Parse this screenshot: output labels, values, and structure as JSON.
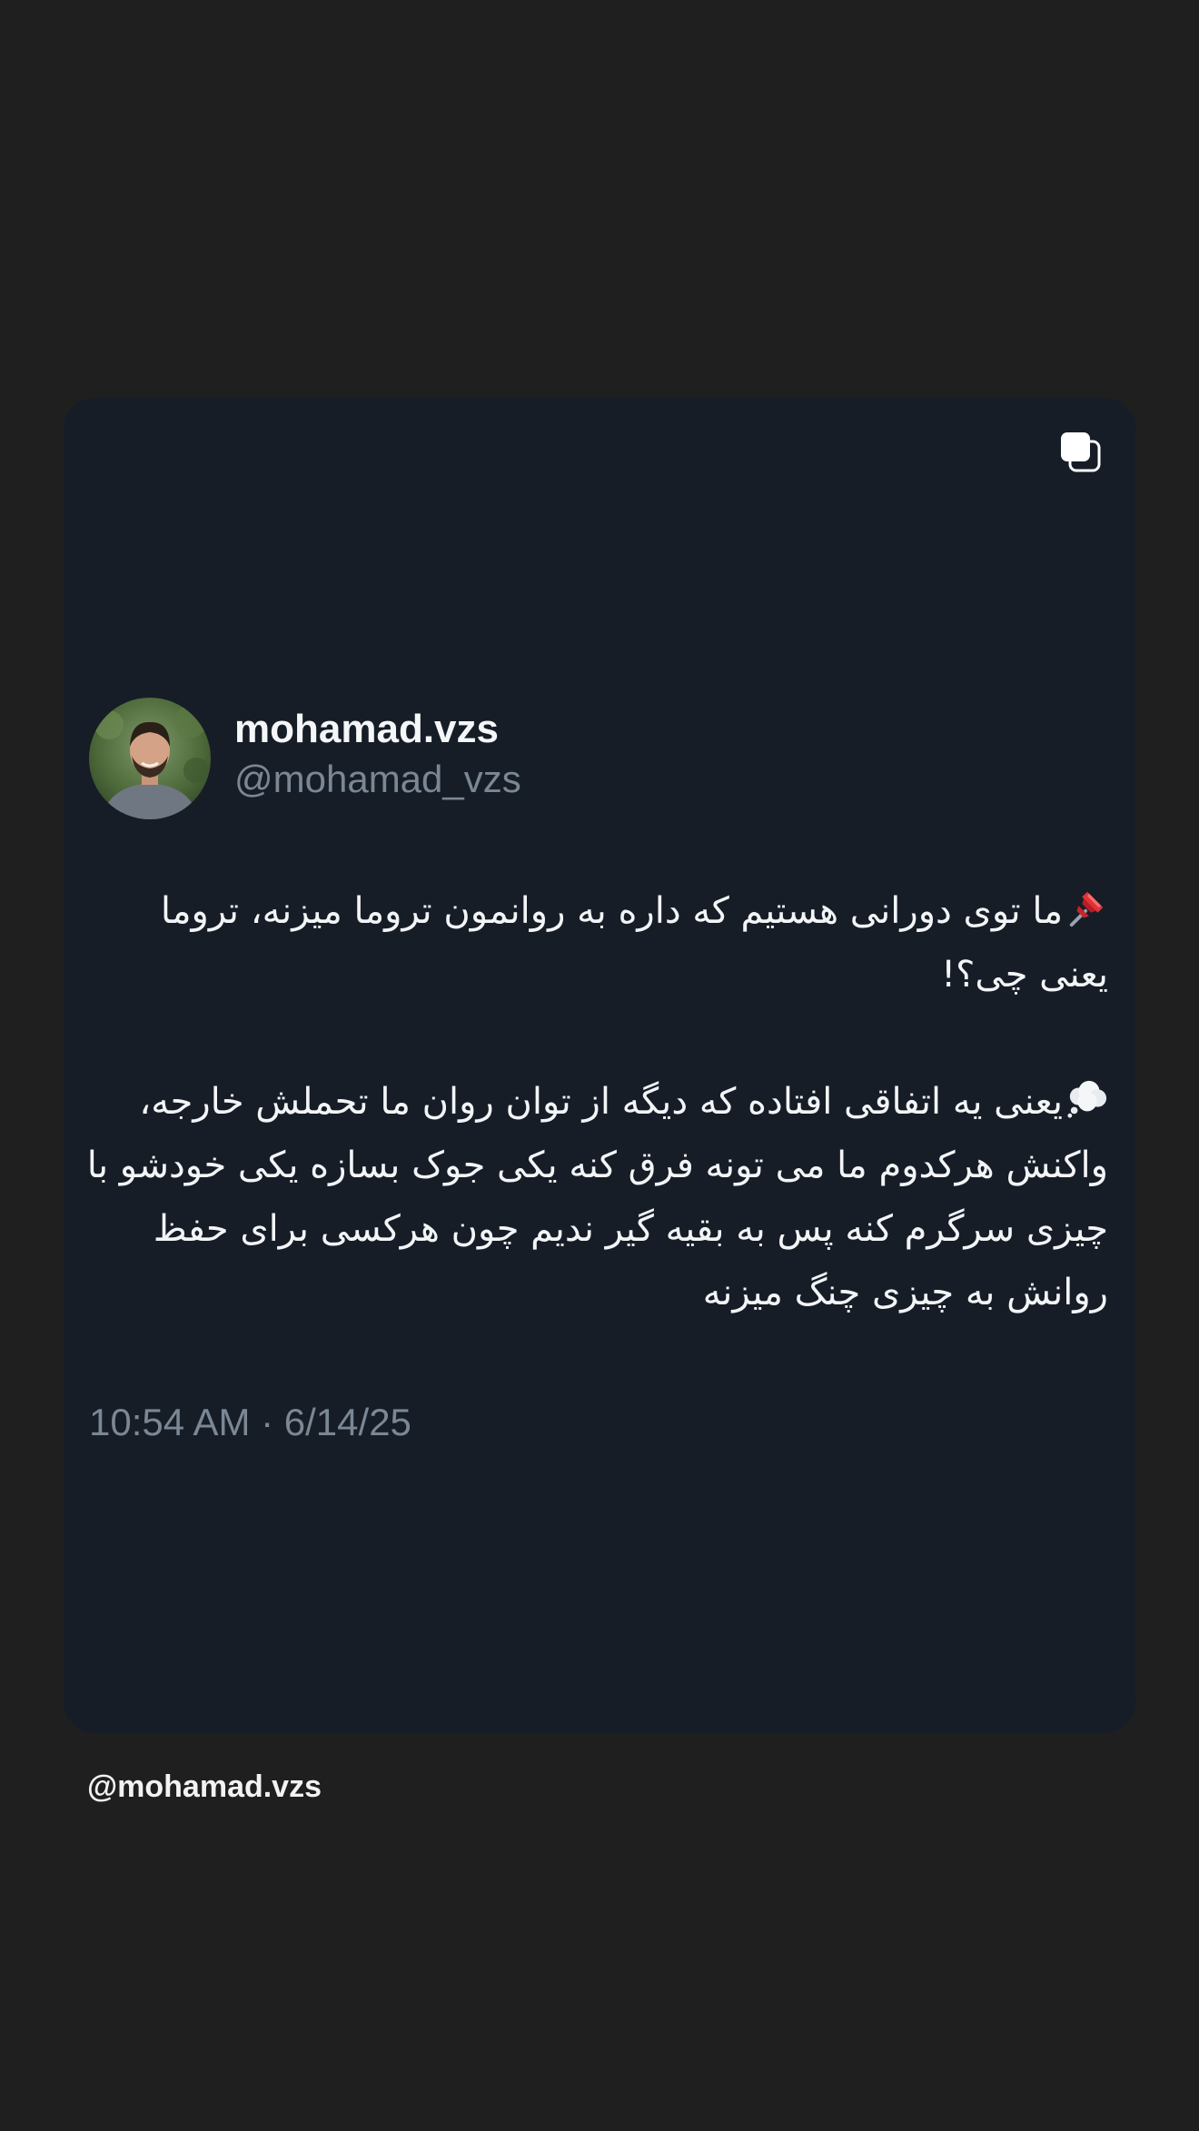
{
  "tweet": {
    "display_name": "mohamad.vzs",
    "handle": "@mohamad_vzs",
    "paragraphs": [
      {
        "icon": "pushpin-icon",
        "text": "ما توی دورانی هستیم که داره به روانمون تروما میزنه، تروما یعنی چی؟!"
      },
      {
        "icon": "thought-balloon-icon",
        "text": "یعنی یه اتفاقی افتاده که دیگه از توان روان ما تحملش خارجه، واکنش هرکدوم ما می تونه فرق کنه یکی جوک بسازه یکی خودشو با چیزی سرگرم کنه پس به بقیه گیر ندیم چون هرکسی برای حفظ روانش به چیزی چنگ میزنه"
      }
    ],
    "timestamp": "10:54 AM · 6/14/25"
  },
  "footer": {
    "handle": "@mohamad.vzs"
  },
  "colors": {
    "page_background": "#1f1f1f",
    "card_background": "#161d27",
    "primary_text": "#f2f4f6",
    "secondary_text": "#7b8794"
  }
}
